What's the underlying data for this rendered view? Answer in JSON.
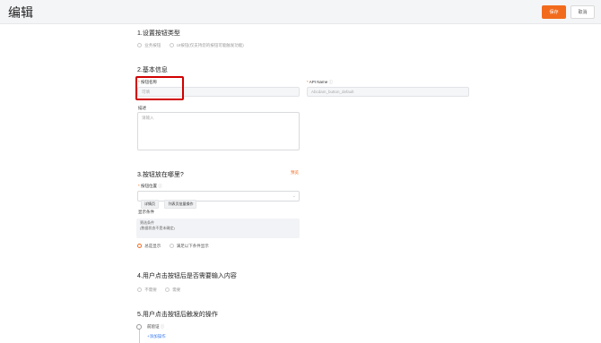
{
  "header": {
    "title": "编辑",
    "save_label": "保存",
    "cancel_label": "取消"
  },
  "section1": {
    "title": "1.设置按钮类型",
    "options": [
      "业务按钮",
      "UI按钮(仅支持您的按钮可能触发功能)"
    ]
  },
  "section2": {
    "title": "2.基本信息",
    "button_name_label": "按钮名称",
    "button_name_placeholder": "可填",
    "api_name_label": "API Name",
    "api_name_value": "Abcdam_button_default",
    "desc_label": "描述",
    "desc_placeholder": "请输入"
  },
  "section3": {
    "title": "3.按钮放在哪里?",
    "edit_link": "预览",
    "position_label": "按钮位置",
    "position_tags": [
      "详情页",
      "列表页批量操作"
    ],
    "condition_label": "显示条件",
    "condition_lines": [
      "筛选条件",
      "(数据状态不是未确定)"
    ],
    "display_options": [
      "总是显示",
      "满足以下条件显示"
    ]
  },
  "section4": {
    "title": "4.用户点击按钮后是否需要输入内容",
    "options": [
      "不需要",
      "需要"
    ]
  },
  "section5": {
    "title": "5.用户点击按钮后触发的操作",
    "pre_validate_label": "前验证",
    "add_action_label": "+添加操作"
  }
}
